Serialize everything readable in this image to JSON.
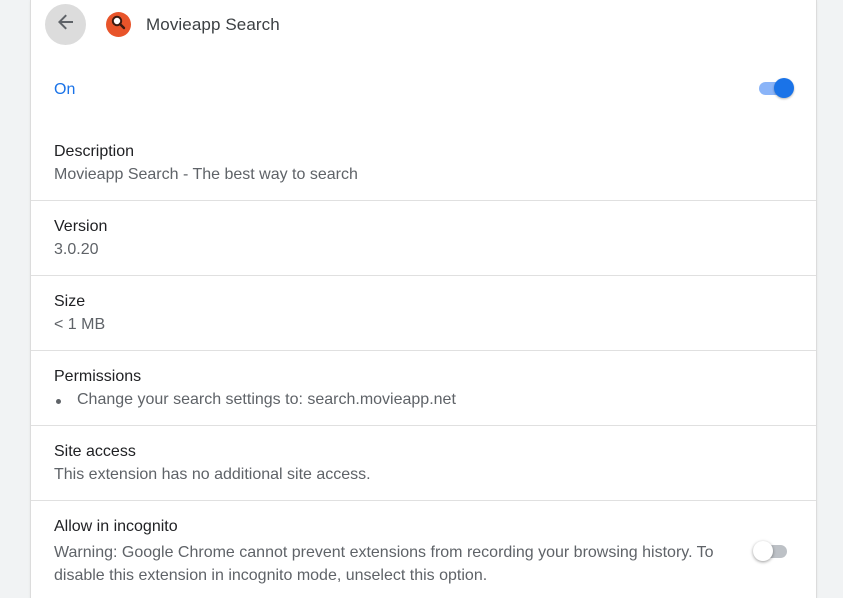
{
  "header": {
    "back_icon": "arrow-left-icon",
    "extension_icon": "magnifier-icon",
    "extension_icon_color": "#e8542a",
    "title": "Movieapp Search"
  },
  "enabled": {
    "label": "On",
    "state": true,
    "accent_color": "#1a73e8"
  },
  "details": {
    "description": {
      "label": "Description",
      "value": "Movieapp Search - The best way to search"
    },
    "version": {
      "label": "Version",
      "value": "3.0.20"
    },
    "size": {
      "label": "Size",
      "value": "< 1 MB"
    },
    "permissions": {
      "label": "Permissions",
      "items": [
        "Change your search settings to: search.movieapp.net"
      ]
    },
    "site_access": {
      "label": "Site access",
      "value": "This extension has no additional site access."
    },
    "incognito": {
      "label": "Allow in incognito",
      "warning": "Warning: Google Chrome cannot prevent extensions from recording your browsing history. To disable this extension in incognito mode, unselect this option.",
      "state": false
    }
  }
}
